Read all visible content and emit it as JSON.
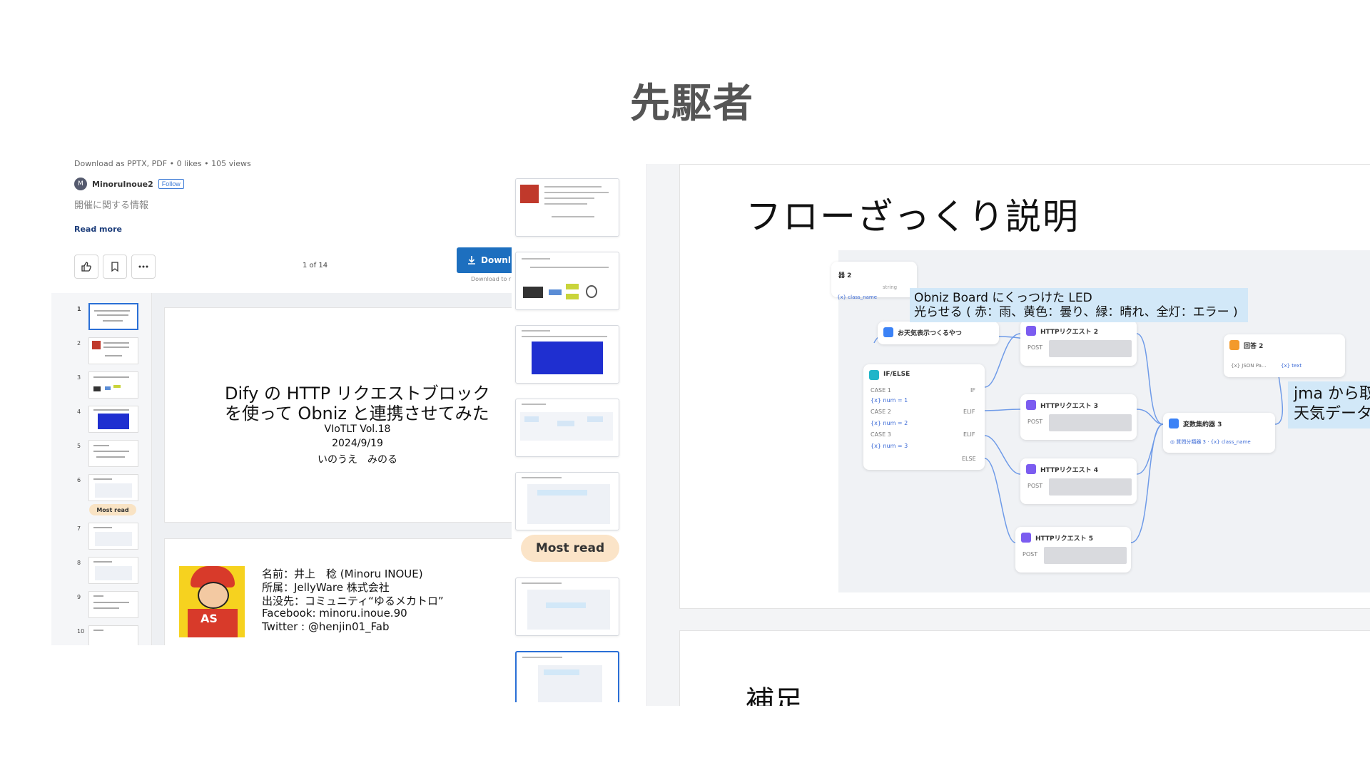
{
  "page": {
    "title": "先駆者"
  },
  "left": {
    "meta": "Download as PPTX, PDF • 0 likes • 105 views",
    "author": {
      "initial": "M",
      "name": "MinoruInoue2",
      "follow": "Follow"
    },
    "description": "開催に関する情報",
    "read_more": "Read more",
    "page_count": "1 of 14",
    "download_label": "Downl",
    "download_note": "Download to r",
    "thumbs": [
      {
        "num": "1"
      },
      {
        "num": "2"
      },
      {
        "num": "3"
      },
      {
        "num": "4"
      },
      {
        "num": "5"
      },
      {
        "num": "6"
      },
      {
        "num": "7"
      },
      {
        "num": "8"
      },
      {
        "num": "9"
      },
      {
        "num": "10"
      }
    ],
    "most_read": "Most read",
    "slide1": {
      "line1": "Dify の HTTP リクエストブロック",
      "line2": "を使って Obniz と連携させてみた",
      "event": "VIoTLT Vol.18",
      "date": "2024/9/19",
      "presenter": "いのうえ　みのる"
    },
    "slide2": {
      "name": "名前：井上　稔 (Minoru INOUE)",
      "affiliation": "所属：JellyWare 株式会社",
      "origin": "出没先：コミュニティ“ゆるメカトロ”",
      "facebook": "Facebook: minoru.inoue.90",
      "twitter": "Twitter : @henjin01_Fab"
    }
  },
  "middle": {
    "most_read": "Most read"
  },
  "right": {
    "title": "フローざっくり説明",
    "note_line1": "Obniz Board にくっつけた LED",
    "note_line2": "光らせる ( 赤：雨、黄色：曇り、緑：晴れ、全灯：エラー )",
    "note2_line1": "jma から取",
    "note2_line2": "天気データ",
    "next_title": "補足",
    "nodes": {
      "weather": "お天気表示つくるやつ",
      "ifelse": "IF/ELSE",
      "http2": "HTTPリクエスト 2",
      "http3": "HTTPリクエスト 3",
      "http4": "HTTPリクエスト 4",
      "http5": "HTTPリクエスト 5",
      "aggregator": "変数集約器 3",
      "answer": "回答 2",
      "post": "POST",
      "case1": "CASE 1",
      "case2": "CASE 2",
      "case3": "CASE 3",
      "num1": "{x} num = 1",
      "num2": "{x} num = 2",
      "num3": "{x} num = 3",
      "if_label": "IF",
      "elif_label": "ELIF",
      "else_label": "ELSE",
      "classifier": "器 2",
      "string_label": "string",
      "class_name": "{x} class_name",
      "json_label": "{x} JSON Pa...",
      "text_label": "{x} text",
      "agg_sub": "◎ 質問分類器 3 · {x} class_name"
    }
  },
  "colors": {
    "accent_blue": "#1d6fbf",
    "badge": "#fbe4c8",
    "note_bg": "#d2e8f8",
    "node_purple": "#7b5cf0",
    "node_teal": "#1fb5c9",
    "node_orange": "#f39a2b"
  }
}
